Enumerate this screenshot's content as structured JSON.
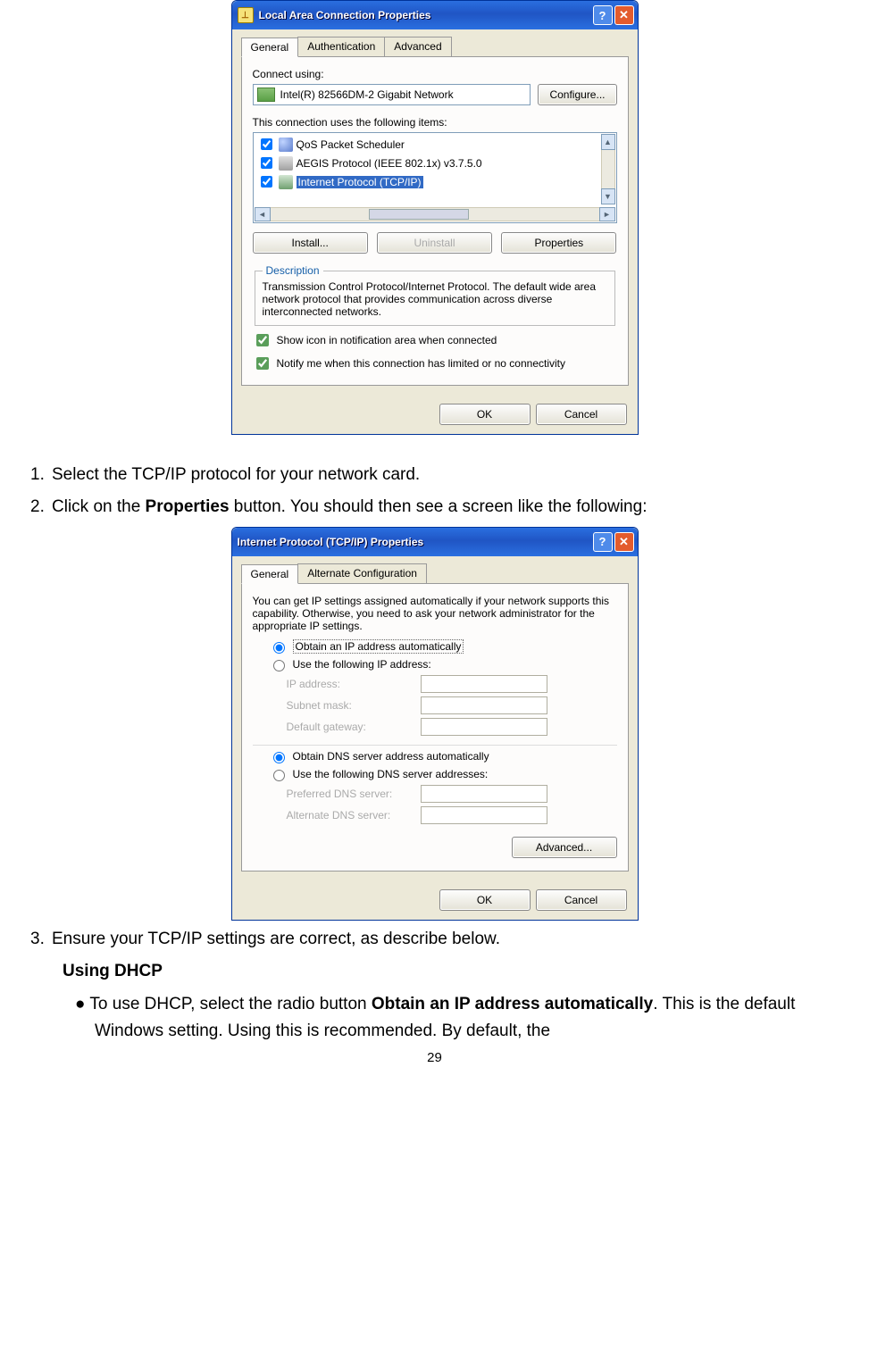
{
  "dialog1": {
    "title": "Local Area Connection Properties",
    "tabs": [
      "General",
      "Authentication",
      "Advanced"
    ],
    "connect_label": "Connect using:",
    "adapter": "Intel(R) 82566DM-2 Gigabit Network",
    "configure_btn": "Configure...",
    "items_label": "This connection uses the following items:",
    "services": [
      {
        "name": "QoS Packet Scheduler",
        "checked": true,
        "icon": "qos",
        "sel": false
      },
      {
        "name": "AEGIS Protocol (IEEE 802.1x) v3.7.5.0",
        "checked": true,
        "icon": "aegis",
        "sel": false
      },
      {
        "name": "Internet Protocol (TCP/IP)",
        "checked": true,
        "icon": "tcpip",
        "sel": true
      }
    ],
    "install_btn": "Install...",
    "uninstall_btn": "Uninstall",
    "properties_btn": "Properties",
    "desc_legend": "Description",
    "desc_text": "Transmission Control Protocol/Internet Protocol. The default wide area network protocol that provides communication across diverse interconnected networks.",
    "chk1": "Show icon in notification area when connected",
    "chk2": "Notify me when this connection has limited or no connectivity",
    "ok_btn": "OK",
    "cancel_btn": "Cancel"
  },
  "instructions": {
    "step1": "Select the TCP/IP protocol for your network card.",
    "step2_a": "Click on the ",
    "step2_b": "Properties",
    "step2_c": " button. You should then see a screen like the following:",
    "step3": "Ensure your TCP/IP settings are correct, as describe below.",
    "dhcp_head": "Using DHCP",
    "bullet_a": "To use DHCP, select the radio button ",
    "bullet_b": "Obtain an IP address automatically",
    "bullet_c": ". This is the default Windows setting. Using this is recommended. By default, the"
  },
  "dialog2": {
    "title": "Internet Protocol (TCP/IP) Properties",
    "tabs": [
      "General",
      "Alternate Configuration"
    ],
    "intro": "You can get IP settings assigned automatically if your network supports this capability. Otherwise, you need to ask your network administrator for the appropriate IP settings.",
    "r1": "Obtain an IP address automatically",
    "r2": "Use the following IP address:",
    "ip_lbl": "IP address:",
    "mask_lbl": "Subnet mask:",
    "gw_lbl": "Default gateway:",
    "r3": "Obtain DNS server address automatically",
    "r4": "Use the following DNS server addresses:",
    "pdns_lbl": "Preferred DNS server:",
    "adns_lbl": "Alternate DNS server:",
    "advanced_btn": "Advanced...",
    "ok_btn": "OK",
    "cancel_btn": "Cancel"
  },
  "page_number": "29"
}
